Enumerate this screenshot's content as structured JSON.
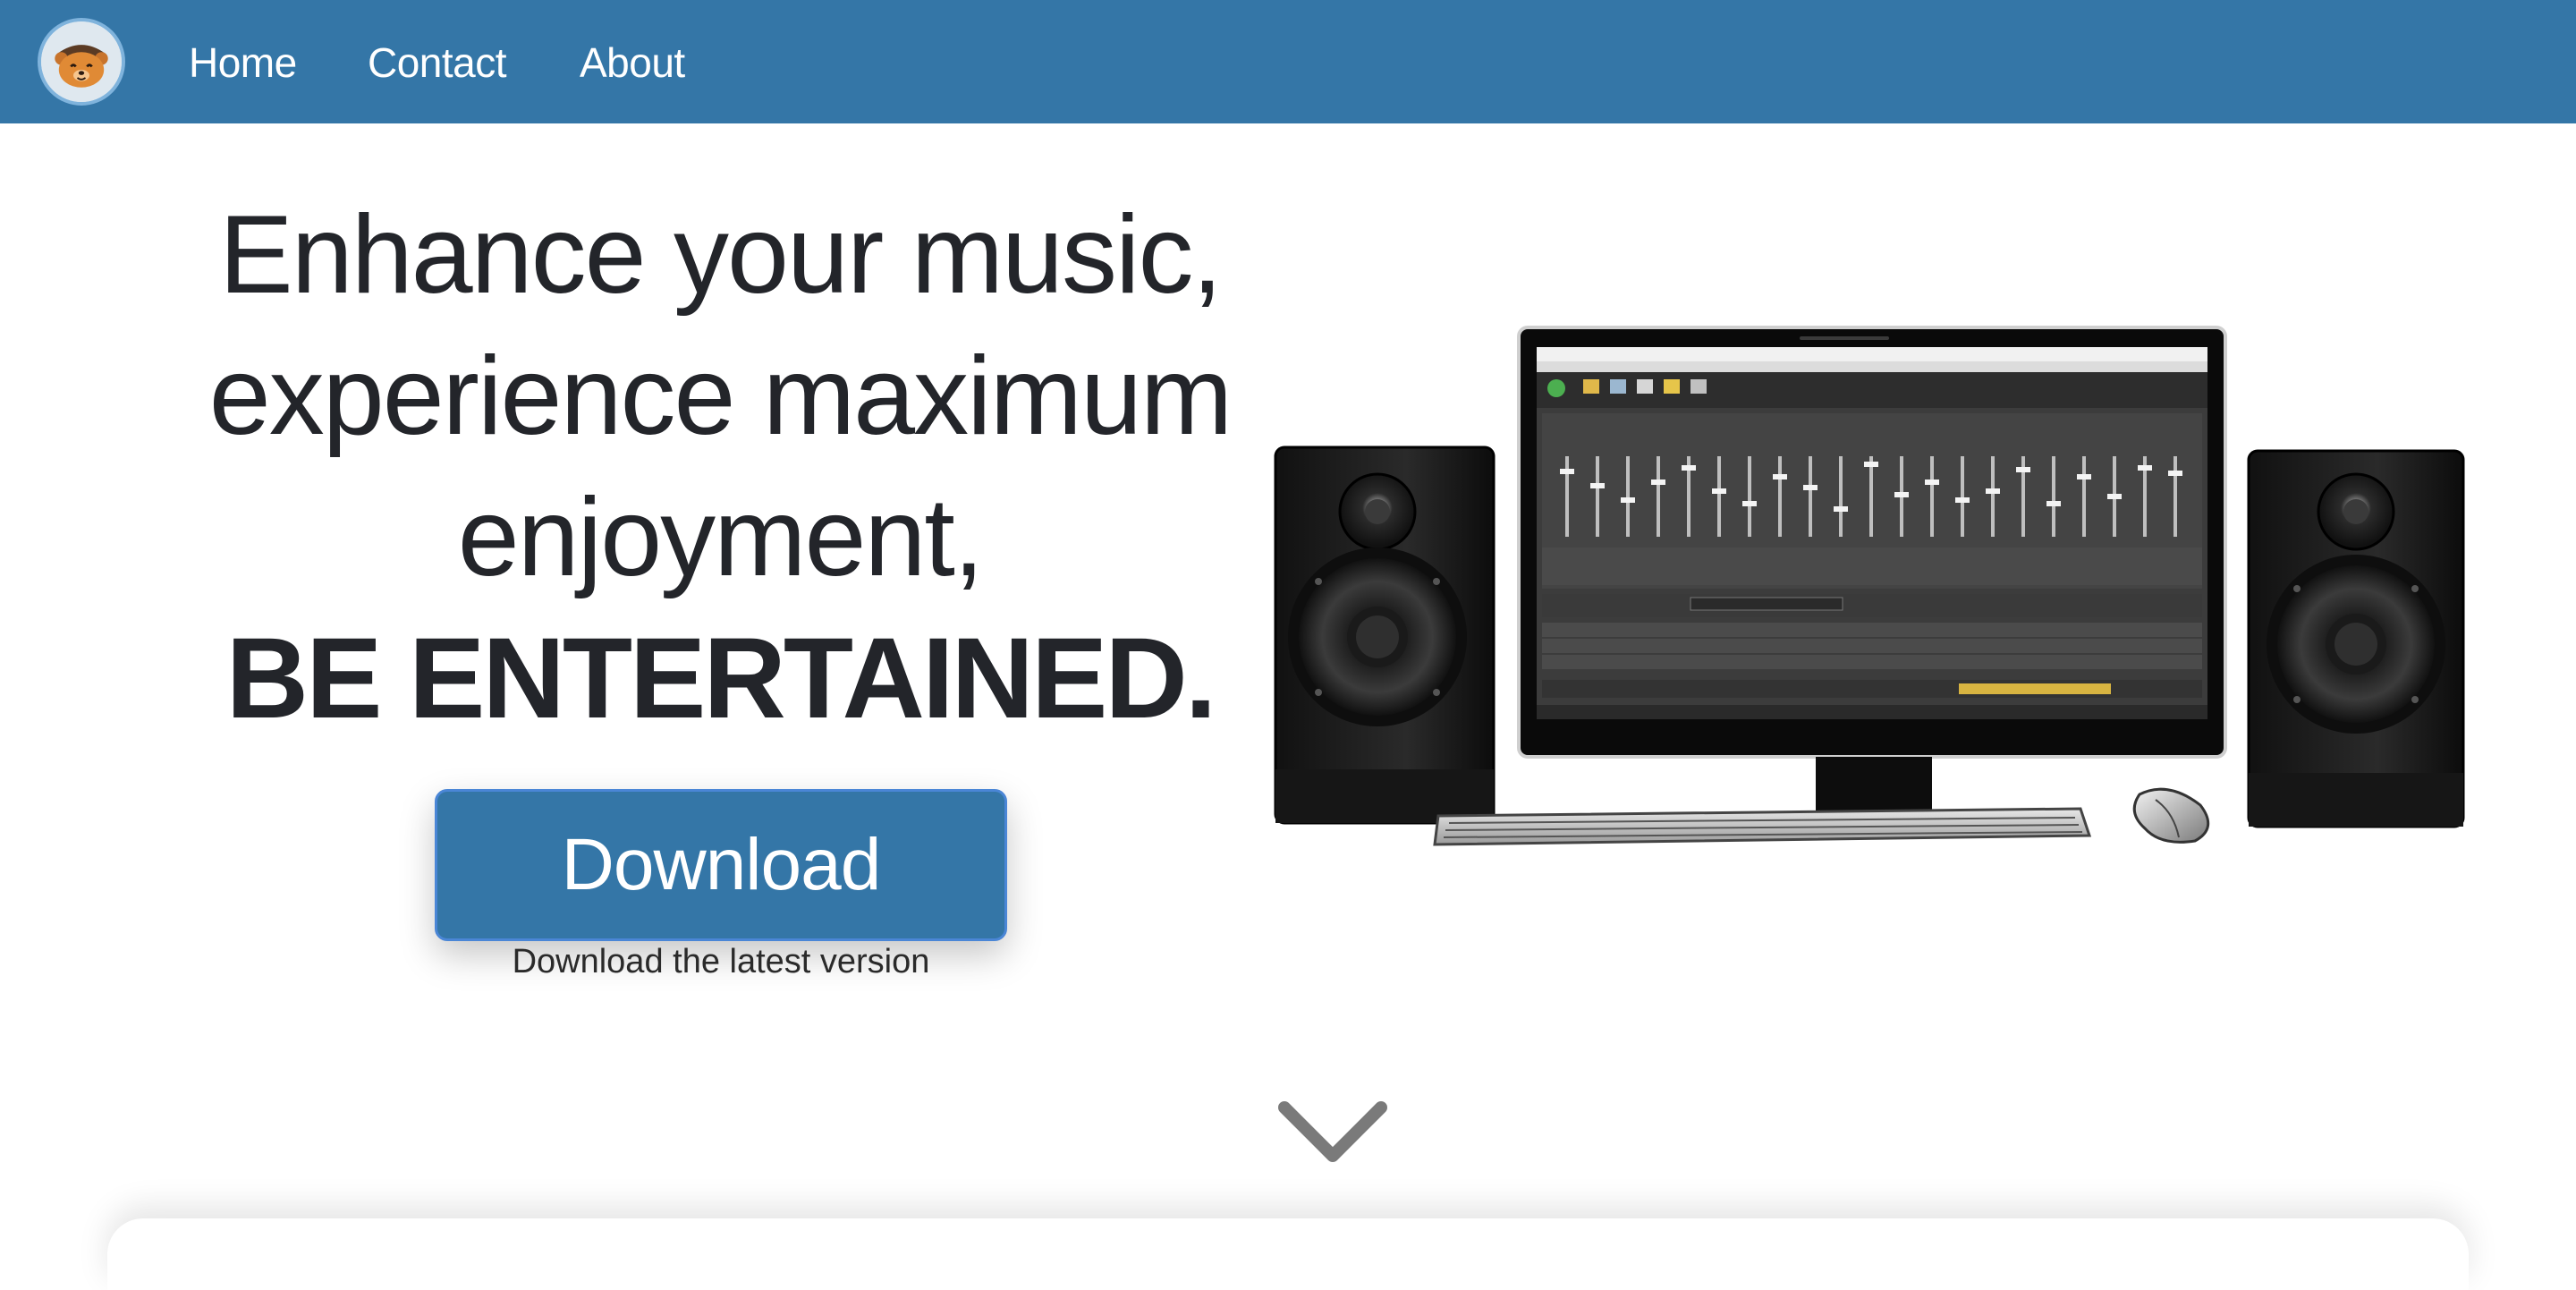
{
  "nav": {
    "logo_alt": "mascot",
    "items": [
      {
        "label": "Home"
      },
      {
        "label": "Contact"
      },
      {
        "label": "About"
      }
    ]
  },
  "hero": {
    "title_lines": [
      "Enhance your music,",
      "experience maximum",
      "enjoyment,"
    ],
    "title_emphasis": "BE ENTERTAINED.",
    "download_button": "Download",
    "download_subtitle": "Download the latest version"
  },
  "icons": {
    "logo": "bear-mascot-icon",
    "scroll": "chevron-down-icon"
  },
  "colors": {
    "navbar": "#3476a7",
    "button": "#3476a7",
    "button_border": "#4a86d6",
    "text": "#23252a",
    "chevron": "#7a7a7a"
  }
}
